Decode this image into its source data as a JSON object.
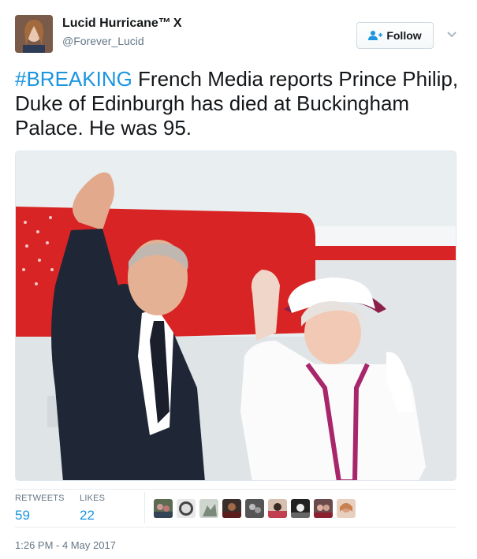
{
  "user": {
    "display_name": "Lucid Hurricane™",
    "badge_text": "X",
    "handle": "@Forever_Lucid",
    "avatar_icon": "profile-photo"
  },
  "follow_button": {
    "label": "Follow",
    "icon": "add-user-icon"
  },
  "tweet": {
    "hashtag": "#BREAKING",
    "text": " French Media reports Prince Philip, Duke of Edinburgh has died at Buckingham Palace. He was 95."
  },
  "stats": {
    "retweets_label": "RETWEETS",
    "retweets_value": "59",
    "likes_label": "LIKES",
    "likes_value": "22"
  },
  "likers_count_shown": 9,
  "timestamp": "1:26 PM - 4 May 2017",
  "colors": {
    "link_blue": "#1b95e0",
    "text_dark": "#14171a",
    "text_muted": "#657786",
    "divider": "#e6ecf0"
  }
}
